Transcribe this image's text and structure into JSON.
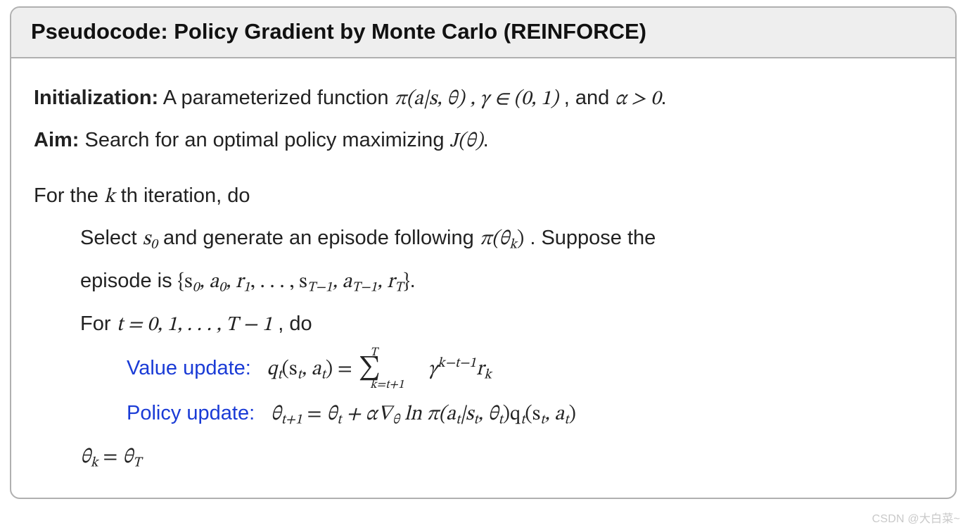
{
  "header": {
    "title": "Pseudocode: Policy Gradient by Monte Carlo (REINFORCE)"
  },
  "body": {
    "init_label": "Initialization:",
    "init_text_a": " A parameterized function ",
    "init_text_b": ", and ",
    "aim_label": "Aim:",
    "aim_text": " Search for an optimal policy maximizing ",
    "loop_a": "For the ",
    "loop_b": "th iteration, do",
    "select_a": "Select ",
    "select_b": " and generate an episode following ",
    "select_c": ".  Suppose the",
    "episode_a": "episode is ",
    "inner_a": "For ",
    "inner_b": ", do",
    "value_label": "Value update:",
    "policy_label": "Policy update:"
  },
  "math": {
    "pi_func": "π(a|s, θ)",
    "gamma_in": "γ ∈ (0, 1)",
    "alpha_gt0": "α > 0",
    "J_theta": "J(θ)",
    "k": "k",
    "s0": "s",
    "s0_sub": "0",
    "pi_thetak": "π(θ",
    "pi_thetak_sub": "k",
    "pi_thetak_close": ")",
    "episode_set_open": "{s",
    "episode_mid1": ", a",
    "episode_mid2": ", r",
    "episode_sub0": "0",
    "episode_sub1": "1",
    "episode_dots": ", . . . , s",
    "episode_Tm1": "T−1",
    "episode_rT": "T",
    "episode_close": "}",
    "t_range": "t = 0, 1, . . . , T − 1",
    "q_lhs_a": "q",
    "q_lhs_sub": "t",
    "q_lhs_b": "(s",
    "q_lhs_c": ", a",
    "q_lhs_d": ") = ",
    "sum_T": "T",
    "sum_lower": "k=t+1",
    "gamma": " γ",
    "gamma_exp": "k−t−1",
    "r": "r",
    "r_sub": "k",
    "theta": "θ",
    "tp1": "t+1",
    "eq": " = ",
    "theta_t": "θ",
    "t": "t",
    "plus_alpha": " + α∇",
    "nabla_sub": "θ",
    "ln_pi": " ln π(a",
    "bar_s": "|s",
    "comma_theta": ", θ",
    "close_q": ")q",
    "close_paren": ")",
    "theta_k": "θ",
    "ksub": "k",
    "theta_T": "θ",
    "Tsub": "T",
    "period": "."
  },
  "watermark": "CSDN @大白菜~"
}
